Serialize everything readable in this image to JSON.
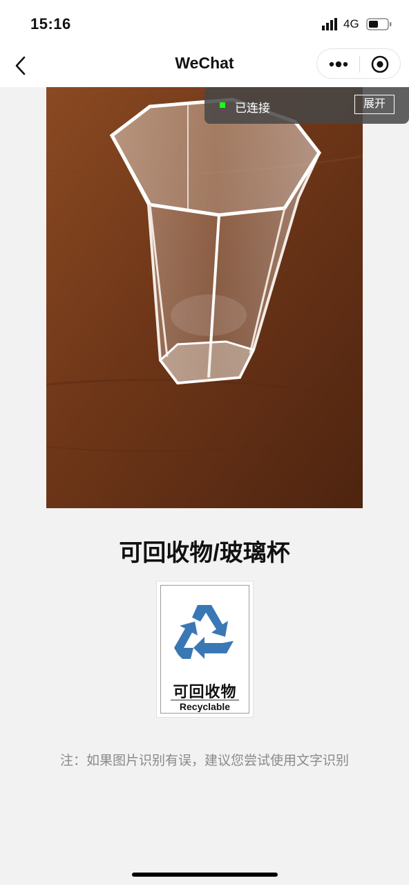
{
  "status_bar": {
    "time": "15:16",
    "network": "4G",
    "icons": [
      "signal-icon",
      "battery-icon"
    ]
  },
  "nav": {
    "title": "WeChat",
    "icons": [
      "back-icon",
      "more-icon",
      "target-icon"
    ]
  },
  "connection": {
    "status": "已连接",
    "expand_label": "展开",
    "dot_color": "#1aff1a"
  },
  "result": {
    "title": "可回收物/玻璃杯",
    "card_cn": "可回收物",
    "card_en": "Recyclable",
    "recycle_color": "#3a78b5"
  },
  "note": "注：如果图片识别有误，建议您尝试使用文字识别"
}
